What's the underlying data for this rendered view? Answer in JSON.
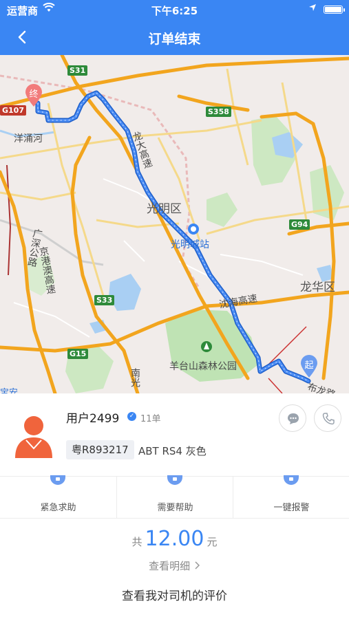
{
  "status_bar": {
    "carrier": "运营商",
    "time": "下午6:25"
  },
  "header": {
    "title": "订单结束"
  },
  "map": {
    "labels": {
      "yangyonghe": "洋涌河",
      "guangming_district": "光明区",
      "guangming_station": "光明城站",
      "longhua_district": "龙华区",
      "yangtai_park": "羊台山森林公园",
      "buling_road": "布龙路",
      "longda_expressway": "龙大高速",
      "shenhai_expressway": "沈海高速",
      "guangshen_road": "广深公路",
      "jinggangao_expressway": "京港澳高速",
      "nanguang": "南光",
      "bao_an": "宝安"
    },
    "shields": {
      "s31": "S31",
      "g107": "G107",
      "s358": "S358",
      "g94": "G94",
      "s33": "S33",
      "g15": "G15"
    },
    "markers": {
      "end": "终",
      "start": "起"
    }
  },
  "driver": {
    "name": "用户2499",
    "orders": "11单",
    "plate": "粤R893217",
    "car": "ABT RS4 灰色"
  },
  "actions": [
    {
      "label": "紧急求助"
    },
    {
      "label": "需要帮助"
    },
    {
      "label": "一键报警"
    }
  ],
  "fare": {
    "prefix": "共",
    "amount": "12.00",
    "unit": "元"
  },
  "links": {
    "detail": "查看明细",
    "review": "查看我对司机的评价"
  },
  "colors": {
    "primary": "#3a86f3",
    "route": "#3a7ff0",
    "end_marker": "#f27b7b",
    "start_marker": "#6b9cf0",
    "avatar": "#f0643c"
  }
}
